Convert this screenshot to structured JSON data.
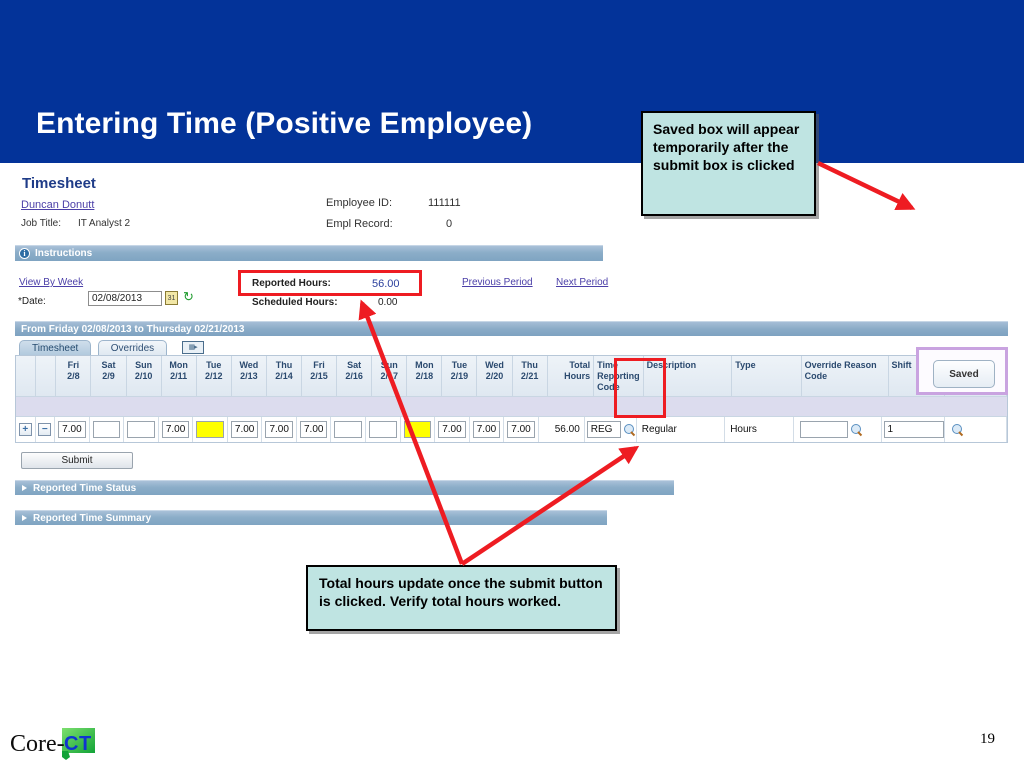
{
  "slide": {
    "title": "Entering Time (Positive Employee)",
    "page_number": "19",
    "logo_text_main": "Core-",
    "logo_text_badge": "CT",
    "banner_color": "#033399"
  },
  "timesheet": {
    "heading": "Timesheet",
    "employee_name": "Duncan Donutt",
    "job_title_label": "Job Title:",
    "job_title_value": "IT Analyst 2",
    "employee_id_label": "Employee ID:",
    "employee_id_value": "111111",
    "empl_record_label": "Empl Record:",
    "empl_record_value": "0",
    "instructions_label": "Instructions",
    "view_by_week_link": "View By Week",
    "date_label": "*Date:",
    "date_value": "02/08/2013",
    "reported_hours_label": "Reported Hours:",
    "reported_hours_value": "56.00",
    "scheduled_hours_label": "Scheduled Hours:",
    "scheduled_hours_value": "0.00",
    "previous_period_link": "Previous Period",
    "next_period_link": "Next Period",
    "period_header": "From Friday 02/08/2013 to Thursday 02/21/2013",
    "tabs": [
      {
        "label": "Timesheet",
        "active": true
      },
      {
        "label": "Overrides",
        "active": false
      }
    ],
    "submit_label": "Submit",
    "saved_label": "Saved",
    "sections": [
      {
        "label": "Reported Time Status"
      },
      {
        "label": "Reported Time Summary"
      }
    ]
  },
  "grid": {
    "day_columns": [
      {
        "day": "Fri",
        "date": "2/8",
        "value": "7.00",
        "highlight": false
      },
      {
        "day": "Sat",
        "date": "2/9",
        "value": "",
        "highlight": false
      },
      {
        "day": "Sun",
        "date": "2/10",
        "value": "",
        "highlight": false
      },
      {
        "day": "Mon",
        "date": "2/11",
        "value": "7.00",
        "highlight": false
      },
      {
        "day": "Tue",
        "date": "2/12",
        "value": "",
        "highlight": true
      },
      {
        "day": "Wed",
        "date": "2/13",
        "value": "7.00",
        "highlight": false
      },
      {
        "day": "Thu",
        "date": "2/14",
        "value": "7.00",
        "highlight": false
      },
      {
        "day": "Fri",
        "date": "2/15",
        "value": "7.00",
        "highlight": false
      },
      {
        "day": "Sat",
        "date": "2/16",
        "value": "",
        "highlight": false
      },
      {
        "day": "Sun",
        "date": "2/17",
        "value": "",
        "highlight": false
      },
      {
        "day": "Mon",
        "date": "2/18",
        "value": "",
        "highlight": true
      },
      {
        "day": "Tue",
        "date": "2/19",
        "value": "7.00",
        "highlight": false
      },
      {
        "day": "Wed",
        "date": "2/20",
        "value": "7.00",
        "highlight": false
      },
      {
        "day": "Thu",
        "date": "2/21",
        "value": "7.00",
        "highlight": false
      }
    ],
    "total_hours_header": "Total Hours",
    "total_hours_value": "56.00",
    "time_reporting_code_header": "Time Reporting Code",
    "time_reporting_code_value": "REG",
    "description_header": "Description",
    "description_value": "Regular",
    "type_header": "Type",
    "type_value": "Hours",
    "override_reason_code_header": "Override Reason Code",
    "override_reason_code_value": "",
    "shift_header": "Shift",
    "shift_value": "1",
    "add_row_label": "+",
    "remove_row_label": "−"
  },
  "annotations": [
    {
      "id": "saved",
      "text": "Saved box will appear temporarily after the submit box is clicked",
      "fill": "#bfe4e2",
      "border": "#000000"
    },
    {
      "id": "total",
      "text": "Total hours update once the submit button is clicked.  Verify total hours worked.",
      "fill": "#bfe4e2",
      "border": "#000000"
    }
  ],
  "highlight_color": "#ee1c22"
}
